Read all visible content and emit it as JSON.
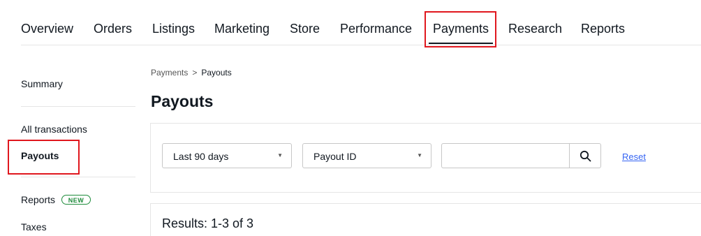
{
  "topnav": {
    "items": [
      {
        "label": "Overview"
      },
      {
        "label": "Orders"
      },
      {
        "label": "Listings"
      },
      {
        "label": "Marketing"
      },
      {
        "label": "Store"
      },
      {
        "label": "Performance"
      },
      {
        "label": "Payments",
        "active": true
      },
      {
        "label": "Research"
      },
      {
        "label": "Reports"
      }
    ]
  },
  "sidebar": {
    "items": [
      {
        "label": "Summary"
      },
      {
        "label": "All transactions"
      },
      {
        "label": "Payouts",
        "active": true
      },
      {
        "label": "Reports",
        "badge": "NEW"
      },
      {
        "label": "Taxes"
      }
    ]
  },
  "breadcrumb": {
    "parent": "Payments",
    "separator": ">",
    "current": "Payouts"
  },
  "main": {
    "title": "Payouts",
    "filters": {
      "date_range": {
        "value": "Last 90 days"
      },
      "search_type": {
        "value": "Payout ID"
      },
      "search": {
        "placeholder": "",
        "value": ""
      },
      "reset_label": "Reset"
    },
    "results": "Results: 1-3 of 3"
  },
  "colors": {
    "highlight": "#e0171e",
    "link": "#3665f3",
    "badge": "#1d8b3a"
  },
  "icons": {
    "search_button": "search-icon",
    "select_caret": "chevron-down-icon"
  }
}
